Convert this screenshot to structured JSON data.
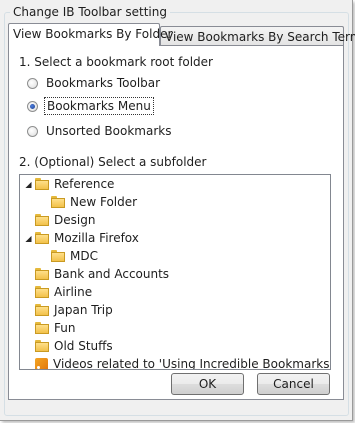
{
  "group": {
    "title": "Change IB Toolbar setting"
  },
  "tabs": [
    {
      "label": "View Bookmarks By Folder",
      "active": true
    },
    {
      "label": "View Bookmarks By Search Terms",
      "active": false
    }
  ],
  "step1": {
    "label": "1. Select a bookmark root folder",
    "options": [
      {
        "label": "Bookmarks Toolbar",
        "checked": false
      },
      {
        "label": "Bookmarks Menu",
        "checked": true
      },
      {
        "label": "Unsorted Bookmarks",
        "checked": false
      }
    ]
  },
  "step2": {
    "label": "2. (Optional) Select a subfolder"
  },
  "tree": {
    "items": [
      {
        "label": "Reference",
        "icon": "folder-icon",
        "expander": "expanded"
      },
      {
        "label": "New Folder",
        "icon": "folder-icon"
      },
      {
        "label": "Design",
        "icon": "folder-icon"
      },
      {
        "label": "Mozilla Firefox",
        "icon": "folder-icon",
        "expander": "expanded"
      },
      {
        "label": "MDC",
        "icon": "folder-icon"
      },
      {
        "label": "Bank and Accounts",
        "icon": "folder-icon"
      },
      {
        "label": "Airline",
        "icon": "folder-icon"
      },
      {
        "label": "Japan Trip",
        "icon": "folder-icon"
      },
      {
        "label": "Fun",
        "icon": "folder-icon"
      },
      {
        "label": "Old Stuffs",
        "icon": "folder-icon"
      },
      {
        "label": "Videos related to 'Using Incredible Bookmarks - A...",
        "icon": "rss-feed-icon"
      }
    ]
  },
  "buttons": {
    "ok": "OK",
    "cancel": "Cancel"
  }
}
